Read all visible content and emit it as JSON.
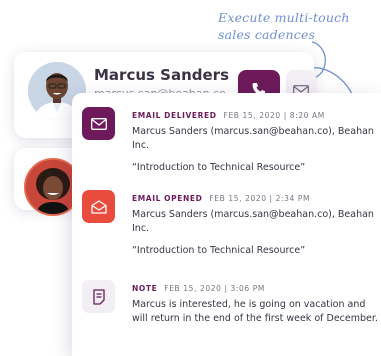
{
  "annotation": {
    "line1": "Execute multi-touch",
    "line2": "sales cadences"
  },
  "contact": {
    "name": "Marcus Sanders",
    "email": "marcus.san@beahan.co"
  },
  "activities": [
    {
      "type": "EMAIL DELIVERED",
      "date": "FEB 15, 2020  |  8:20 AM",
      "text": "Marcus Sanders (marcus.san@beahan.co), Beahan Inc.",
      "quote": "“Introduction to Technical Resource”",
      "icon": "envelope-icon"
    },
    {
      "type": "EMAIL OPENED",
      "date": "FEB 15, 2020  |  2:34 PM",
      "text": "Marcus Sanders (marcus.san@beahan.co), Beahan Inc.",
      "quote": "“Introduction to Technical Resource”",
      "icon": "open-envelope-icon"
    },
    {
      "type": "NOTE",
      "date": "FEB 15, 2020  |  3:06 PM",
      "text": "Marcus is interested, he is going on vacation and will return in the end of the first week of December.",
      "icon": "note-icon"
    }
  ],
  "colors": {
    "accent": "#6e1a5a",
    "opened": "#e94c3d",
    "annotation": "#6f8fd2"
  }
}
